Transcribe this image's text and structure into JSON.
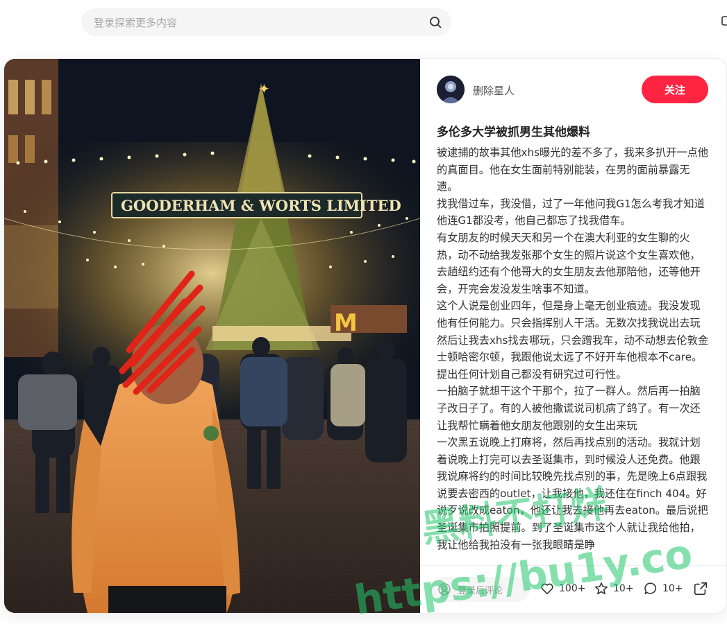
{
  "search": {
    "placeholder": "登录探索更多内容"
  },
  "photo": {
    "sign_text": "GOODERHAM & WORTS LIMITED"
  },
  "note": {
    "author": "删除星人",
    "follow_label": "关注",
    "title": "多伦多大学被抓男生其他爆料",
    "paragraphs": [
      "被逮捕的故事其他xhs曝光的差不多了，我来多扒开一点他的真面目。他在女生面前特别能装，在男的面前暴露无遗。",
      "找我借过车，我没借，过了一年他问我G1怎么考我才知道他连G1都没考，他自己都忘了找我借车。",
      "",
      "有女朋友的时候天天和另一个在澳大利亚的女生聊的火热，动不动给我发张那个女生的照片说这个女生喜欢他，去趟纽约还有个他哥大的女生朋友去他那陪他，还等他开会，开完会发没发生啥事不知道。",
      "这个人说是创业四年，但是身上毫无创业痕迹。我没发现他有任何能力。只会指挥别人干活。无数次找我说出去玩然后让我去xhs找去哪玩，只会蹭我车，动不动想去伦敦金士顿哈密尔顿，我跟他说太远了不好开车他根本不care。提出任何计划自己都没有研究过可行性。",
      "一拍脑子就想干这个干那个，拉了一群人。然后再一拍脑子改日子了。有的人被他撒谎说司机病了鸽了。有一次还让我帮忙瞒着他女朋友他跟别的女生出来玩",
      "一次黑五说晚上打麻将，然后再找点别的活动。我就计划着说晚上打完可以去圣诞集市，到时候没人还免费。他跟我说麻将约的时间比较晚先找点别的事，先是晚上6点跟我说要去密西的outlet，让我接他，我还住在finch 404。好说歹说改成eaton，他还让我去接他再去eaton。最后说把圣诞集市拍照提前。到了圣诞集市这个人就让我给他拍，我让他给我拍没有一张我眼睛是睁"
    ],
    "comment_placeholder": "登录后评论",
    "likes": "100+",
    "collects": "10+",
    "comments": "10+"
  },
  "watermark": {
    "line1": "黑料不打烊",
    "line2": "https://bu1y.co"
  },
  "colors": {
    "accent": "#ff2442",
    "watermark": "#22c76b"
  },
  "icons": [
    "search-icon",
    "user-icon",
    "heart-icon",
    "star-icon",
    "comment-icon",
    "share-icon"
  ]
}
